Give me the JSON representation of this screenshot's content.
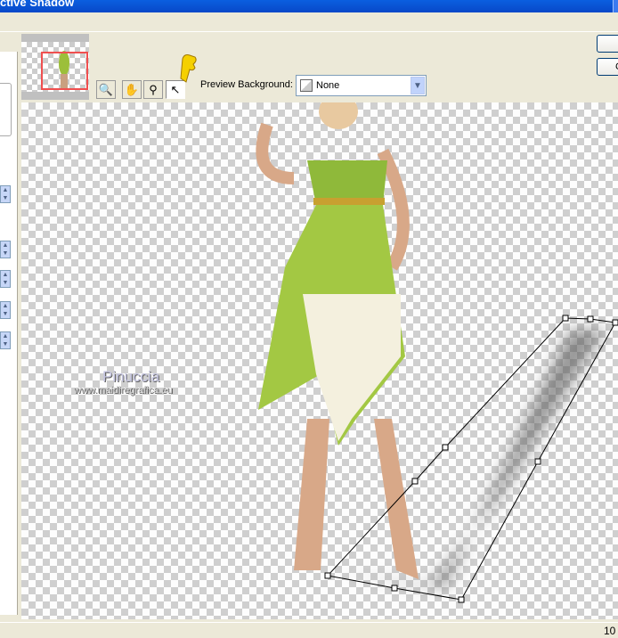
{
  "window": {
    "title": "ctive Shadow"
  },
  "toolbar": {
    "tools": [
      {
        "name": "pan-zoom",
        "icon": "preview-icon"
      },
      {
        "name": "pan",
        "icon": "hand-icon"
      },
      {
        "name": "zoom",
        "icon": "magnifier-icon"
      },
      {
        "name": "pointer",
        "icon": "arrow-icon",
        "active": true
      }
    ],
    "preview_background_label": "Preview Background:",
    "preview_background_value": "None"
  },
  "buttons": {
    "ok": "",
    "cancel": "C"
  },
  "watermark": {
    "line1": "Pinuccia",
    "line2": "www.maidiregrafica.eu"
  },
  "status": {
    "zoom": "10"
  },
  "colors": {
    "titlebar": "#0a5fe0",
    "thumb_frame": "#f05050",
    "annotation_hand": "#f5d000"
  }
}
